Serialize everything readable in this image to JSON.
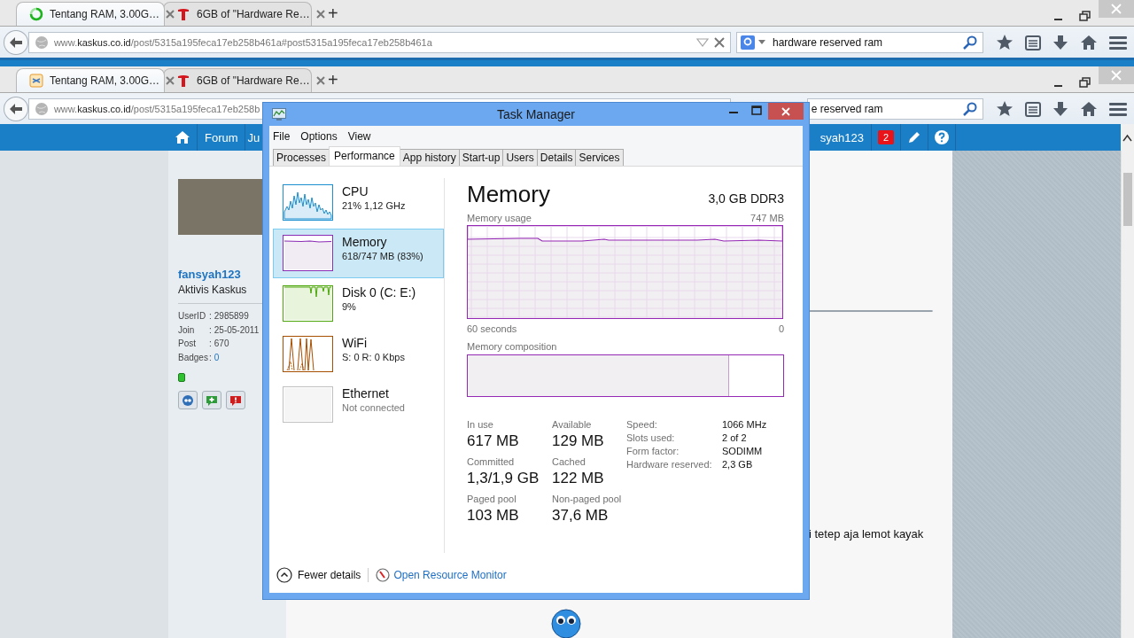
{
  "outer_browser": {
    "tabs": [
      {
        "title": "Tentang RAM, 3.00G…",
        "selected": true
      },
      {
        "title": "6GB of \"Hardware Re…",
        "selected": false
      }
    ],
    "new_tab": "+",
    "url": {
      "prefix": "www.",
      "host": "kaskus.co.id",
      "path": "/post/5315a195feca17eb258b461a#post5315a195feca17eb258b461a"
    },
    "search": {
      "value": "hardware reserved ram"
    }
  },
  "inner_browser": {
    "tabs": [
      {
        "title": "Tentang RAM, 3.00G…",
        "selected": true
      },
      {
        "title": "6GB of \"Hardware Re…",
        "selected": false
      }
    ],
    "new_tab": "+",
    "url": {
      "prefix": "www.",
      "host": "kaskus.co.id",
      "path": "/post/5315a195feca17eb258b"
    },
    "search": {
      "value": "e reserved ram"
    }
  },
  "site_nav": {
    "links": [
      "Forum",
      "Ju"
    ],
    "user": "syah123",
    "notifications": "2"
  },
  "user_panel": {
    "username": "fansyah123",
    "rank": "Aktivis Kaskus",
    "stats": [
      {
        "label": "UserID",
        "colon": ":",
        "value": "2985899",
        "kind": "text"
      },
      {
        "label": "Join",
        "colon": ":",
        "value": "25-05-2011",
        "kind": "text"
      },
      {
        "label": "Post",
        "colon": ":",
        "value": "670",
        "kind": "text"
      },
      {
        "label": "Badges",
        "colon": ":",
        "value": "0",
        "kind": "link"
      }
    ],
    "online": true
  },
  "post": {
    "text": "i tetep aja lemot kayak"
  },
  "task_manager": {
    "title": "Task Manager",
    "menu": [
      "File",
      "Options",
      "View"
    ],
    "tabs": [
      {
        "label": "Processes",
        "selected": false
      },
      {
        "label": "Performance",
        "selected": true
      },
      {
        "label": "App history",
        "selected": false
      },
      {
        "label": "Start-up",
        "selected": false
      },
      {
        "label": "Users",
        "selected": false
      },
      {
        "label": "Details",
        "selected": false
      },
      {
        "label": "Services",
        "selected": false
      }
    ],
    "resources": [
      {
        "kind": "cpu",
        "name": "CPU",
        "detail": "21%  1,12 GHz",
        "color": "#1b8fd0",
        "selected": false
      },
      {
        "kind": "memory",
        "name": "Memory",
        "detail": "618/747 MB (83%)",
        "color": "#8b2cb5",
        "selected": true
      },
      {
        "kind": "disk",
        "name": "Disk 0 (C: E:)",
        "detail": "9%",
        "color": "#4da60c",
        "selected": false
      },
      {
        "kind": "wifi",
        "name": "WiFi",
        "detail": "S: 0 R: 0 Kbps",
        "color": "#a74f01",
        "selected": false
      },
      {
        "kind": "ethernet",
        "name": "Ethernet",
        "detail": "Not connected",
        "color": "#c0c0c0",
        "selected": false
      }
    ],
    "detail": {
      "title": "Memory",
      "spec": "3,0 GB DDR3",
      "usage_label": "Memory usage",
      "usage_max": "747 MB",
      "time_start": "60 seconds",
      "time_end": "0",
      "composition_label": "Memory composition",
      "composition": {
        "level": 0.83
      },
      "stats": [
        {
          "label": "In use",
          "value": "617 MB"
        },
        {
          "label": "Available",
          "value": "129 MB"
        },
        {
          "label": "Committed",
          "value": "1,3/1,9 GB"
        },
        {
          "label": "Cached",
          "value": "122 MB"
        },
        {
          "label": "Paged pool",
          "value": "103 MB"
        },
        {
          "label": "Non-paged pool",
          "value": "37,6 MB"
        }
      ],
      "specs": [
        {
          "label": "Speed:",
          "value": "1066 MHz"
        },
        {
          "label": "Slots used:",
          "value": "2 of 2"
        },
        {
          "label": "Form factor:",
          "value": "SODIMM"
        },
        {
          "label": "Hardware reserved:",
          "value": "2,3 GB"
        }
      ]
    },
    "footer": {
      "fewer": "Fewer details",
      "monitor": "Open Resource Monitor"
    }
  }
}
